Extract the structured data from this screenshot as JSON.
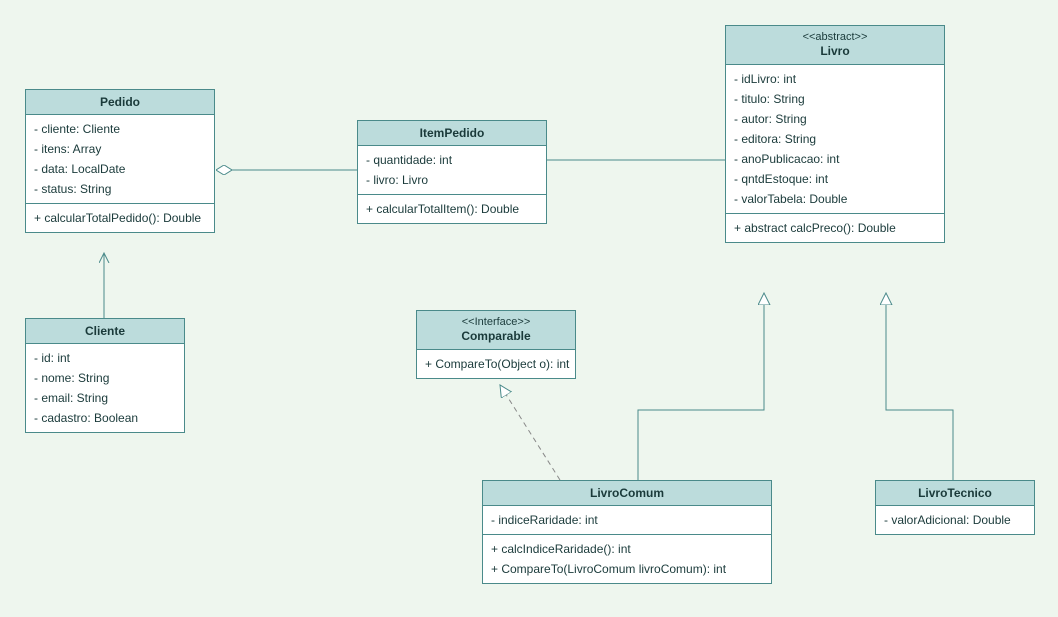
{
  "classes": {
    "pedido": {
      "title": "Pedido",
      "attrs": [
        "- cliente: Cliente",
        "- itens: Array",
        "- data: LocalDate",
        "- status: String"
      ],
      "ops": [
        "+ calcularTotalPedido(): Double"
      ]
    },
    "cliente": {
      "title": "Cliente",
      "attrs": [
        "- id: int",
        "- nome: String",
        "- email: String",
        "- cadastro: Boolean"
      ]
    },
    "itemPedido": {
      "title": "ItemPedido",
      "attrs": [
        "- quantidade: int",
        "- livro: Livro"
      ],
      "ops": [
        "+ calcularTotalItem(): Double"
      ]
    },
    "livro": {
      "stereo": "<<abstract>>",
      "title": "Livro",
      "attrs": [
        "- idLivro: int",
        "- titulo: String",
        "- autor: String",
        "- editora: String",
        "- anoPublicacao: int",
        "- qntdEstoque: int",
        "- valorTabela: Double"
      ],
      "ops": [
        "+ abstract calcPreco(): Double"
      ]
    },
    "comparable": {
      "stereo": "<<Interface>>",
      "title": "Comparable",
      "ops": [
        "+ CompareTo(Object o): int"
      ]
    },
    "livroComum": {
      "title": "LivroComum",
      "attrs": [
        "- indiceRaridade: int"
      ],
      "ops": [
        "+ calcIndiceRaridade(): int",
        "+ CompareTo(LivroComum livroComum): int"
      ]
    },
    "livroTecnico": {
      "title": "LivroTecnico",
      "attrs": [
        "- valorAdicional: Double"
      ]
    }
  }
}
